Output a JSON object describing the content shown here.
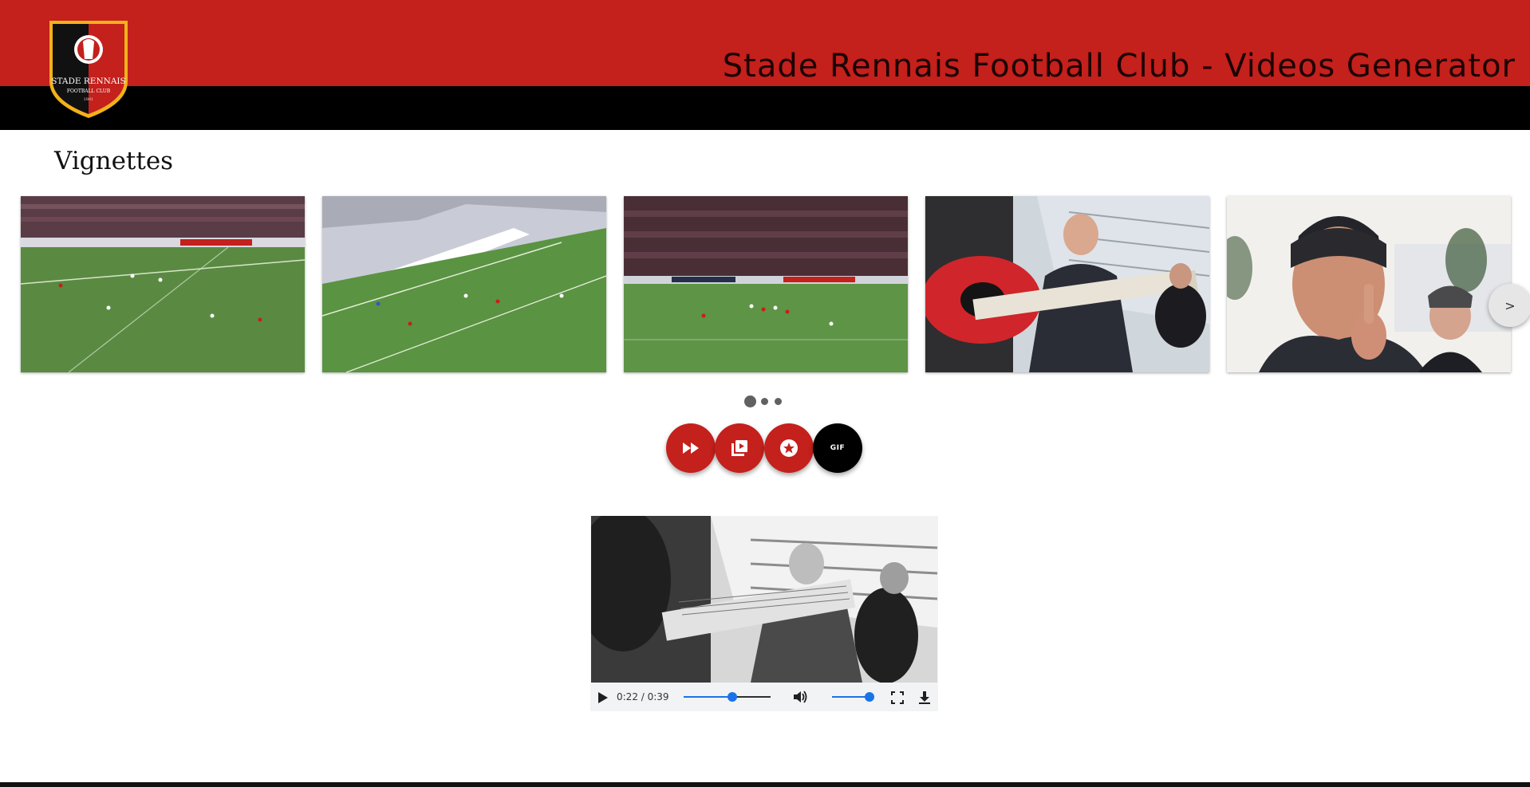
{
  "header": {
    "title": "Stade Rennais Football Club - Videos Generator",
    "logo": {
      "icon": "club-crest",
      "text_main": "STADE RENNAIS",
      "text_sub": "FOOTBALL CLUB",
      "year": "1901"
    },
    "colors": {
      "primary_red": "#c4201c",
      "black": "#000000"
    }
  },
  "vignettes": {
    "title": "Vignettes",
    "items": [
      {
        "name": "vignette-1",
        "description": "stadium-match-scene"
      },
      {
        "name": "vignette-2",
        "description": "stadium-match-scene"
      },
      {
        "name": "vignette-3",
        "description": "stadium-match-scene"
      },
      {
        "name": "vignette-4",
        "description": "guitar-music-video-scene"
      },
      {
        "name": "vignette-5",
        "description": "pointing-man-scene"
      }
    ],
    "next_label": ">",
    "pagination": {
      "pages": 3,
      "active": 1
    }
  },
  "actions": {
    "fast_forward_icon": "fast-forward-icon",
    "video_library_icon": "video-library-icon",
    "star_icon": "star-icon",
    "gif_label": "GIF"
  },
  "player": {
    "time": "0:22 / 0:39",
    "progress": 0.564,
    "volume": 0.95,
    "icons": [
      "play-icon",
      "volume-icon",
      "fullscreen-icon",
      "download-icon"
    ]
  }
}
